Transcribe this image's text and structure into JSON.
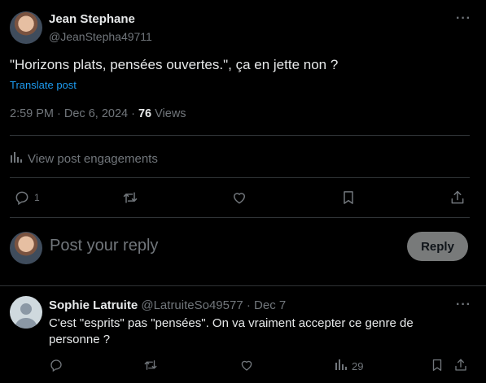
{
  "post": {
    "author_name": "Jean Stephane",
    "author_handle": "@JeanStepha49711",
    "more": "···",
    "text": "\"Horizons plats, pensées ouvertes.\", ça en jette non ?",
    "translate_label": "Translate post",
    "time": "2:59 PM · Dec 6, 2024 · ",
    "views_count": "76",
    "views_label": " Views",
    "engagements_label": "View post engagements",
    "reply_count": "1"
  },
  "composer": {
    "placeholder": "Post your reply",
    "reply_button": "Reply"
  },
  "reply": {
    "author_name": "Sophie Latruite",
    "author_handle": "@LatruiteSo49577",
    "date": " · Dec 7",
    "more": "···",
    "text": "C'est \"esprits\" pas \"pensées\". On va vraiment accepter ce genre de personne ?",
    "views_count": "29"
  },
  "colors": {
    "background": "#000000",
    "text": "#e7e9ea",
    "secondary": "#71767b",
    "link": "#1d9bf0",
    "divider": "#2f3336"
  }
}
